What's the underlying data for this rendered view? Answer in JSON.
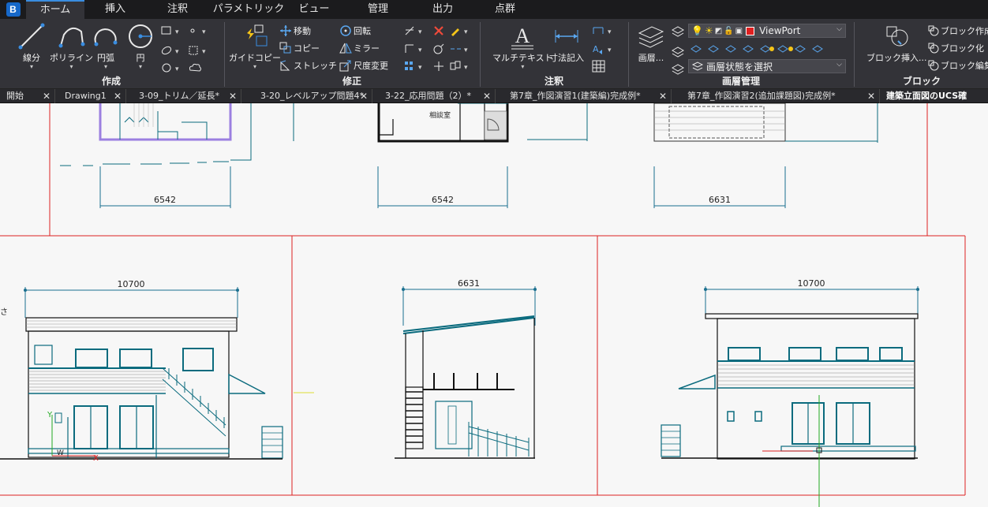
{
  "menu": {
    "tabs": [
      "ホーム",
      "挿入",
      "注釈",
      "パラメトリック",
      "ビュー",
      "管理",
      "出力",
      "点群"
    ]
  },
  "ribbon": {
    "create": {
      "title": "作成",
      "polyline_label": "線分",
      "polyline2_label": "ポリライン",
      "arc_label": "円弧",
      "circle_label": "円"
    },
    "modify": {
      "title": "修正",
      "guide_copy_label": "ガイドコピー",
      "move_label": "移動",
      "rotate_label": "回転",
      "copy_label": "コピー",
      "mirror_label": "ミラー",
      "stretch_label": "ストレッチ",
      "scale_label": "尺度変更"
    },
    "annotation": {
      "title": "注釈",
      "mtext_label": "マルチテキスト",
      "dim_label": "寸法記入"
    },
    "layers": {
      "title": "画層管理",
      "layer_label": "画層...",
      "current_layer": "ViewPort",
      "layer_state": "画層状態を選択",
      "layer_color": "#e02020"
    },
    "block": {
      "title": "ブロック",
      "insert_label": "ブロック挿入...",
      "create_label": "ブロック作成",
      "blockify_label": "ブロック化",
      "edit_label": "ブロック編集"
    }
  },
  "doc_tabs": [
    {
      "label": "開始"
    },
    {
      "label": "Drawing1"
    },
    {
      "label": "3-09_トリム／延長*"
    },
    {
      "label": "3-20_レベルアップ問題4*"
    },
    {
      "label": "3-22_応用問題（2）*"
    },
    {
      "label": "第7章_作図演習1(建築編)完成例*"
    },
    {
      "label": "第7章_作図演習2(追加課題図)完成例*"
    },
    {
      "label": "建築立面図のUCS確"
    }
  ],
  "drawing": {
    "top_dims": [
      "6542",
      "6542",
      "6631"
    ],
    "bottom_dims": [
      "10700",
      "6631",
      "10700"
    ],
    "room_label": "相談室",
    "edge_char": "さ",
    "ucs_y": "Y",
    "ucs_x": "X",
    "ucs_w": "W"
  },
  "colors": {
    "accent": "#3a8de0",
    "viewport_border": "#d22",
    "dim_line": "#1a6f8f",
    "cyan_lines": "#0b6b7e",
    "purple": "#9b7fe0"
  }
}
